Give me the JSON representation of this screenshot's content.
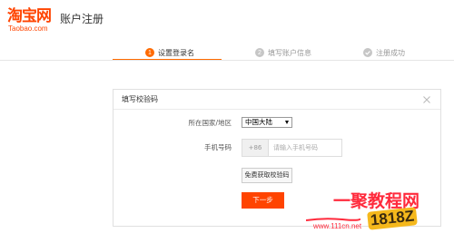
{
  "header": {
    "logo_cn": "淘宝网",
    "logo_en": "Taobao.com",
    "page_title": "账户注册"
  },
  "steps": [
    {
      "number": "1",
      "label": "设置登录名",
      "state": "active"
    },
    {
      "number": "2",
      "label": "填写账户信息",
      "state": "pending"
    },
    {
      "number": "",
      "label": "注册成功",
      "state": "pending"
    }
  ],
  "dialog": {
    "title": "填写校验码",
    "country_label": "所在国家/地区",
    "country_value": "中国大陆",
    "phone_label": "手机号码",
    "phone_prefix": "+86",
    "phone_placeholder": "请输入手机号码",
    "code_button": "免费获取校验码",
    "next_button": "下一步"
  },
  "watermark": {
    "text": "一聚教程网",
    "url": "www.111cn.net",
    "badge": "1818Z"
  },
  "colors": {
    "brand": "#ff4400",
    "step_active": "#ff6a00",
    "watermark": "#ff2a3c"
  },
  "icons": {
    "step3": "check-circle-icon",
    "dialog_close": "close-icon",
    "country_caret": "caret-down-icon"
  }
}
